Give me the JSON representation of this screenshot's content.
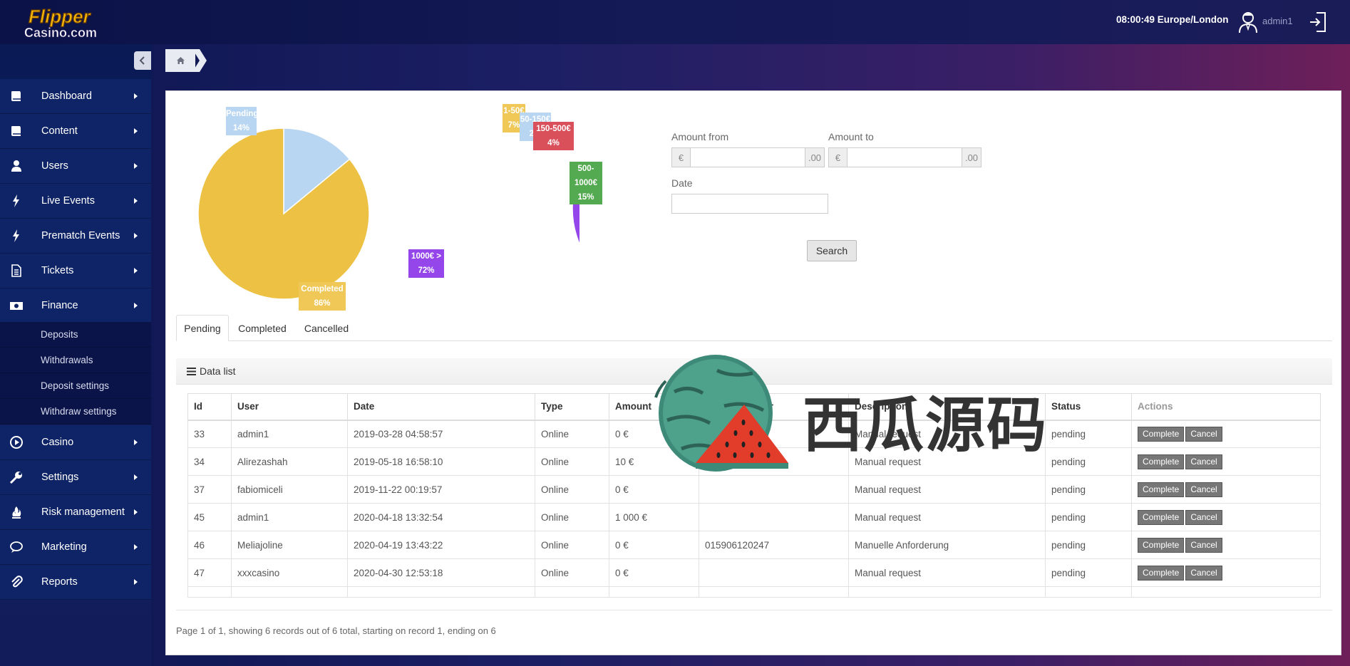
{
  "header": {
    "logo_text": "Flipper Casino.com",
    "clock": "08:00:49 Europe/London",
    "user": "admin1"
  },
  "sidebar": {
    "items": [
      {
        "label": "Dashboard",
        "icon": "book-icon"
      },
      {
        "label": "Content",
        "icon": "book-icon"
      },
      {
        "label": "Users",
        "icon": "user-icon"
      },
      {
        "label": "Live Events",
        "icon": "bolt-icon"
      },
      {
        "label": "Prematch Events",
        "icon": "bolt-icon"
      },
      {
        "label": "Tickets",
        "icon": "document-icon"
      },
      {
        "label": "Finance",
        "icon": "money-icon"
      },
      {
        "label": "Casino",
        "icon": "play-icon"
      },
      {
        "label": "Settings",
        "icon": "wrench-icon"
      },
      {
        "label": "Risk management",
        "icon": "fire-icon"
      },
      {
        "label": "Marketing",
        "icon": "chat-icon"
      },
      {
        "label": "Reports",
        "icon": "paperclip-icon"
      }
    ],
    "finance_subitems": [
      "Deposits",
      "Withdrawals",
      "Deposit settings",
      "Withdraw settings"
    ]
  },
  "chart_data": [
    {
      "type": "pie",
      "slices": [
        {
          "label": "Pending",
          "value": 14,
          "color": "#b8d6f1"
        },
        {
          "label": "Completed",
          "value": 86,
          "color": "#ecc144"
        }
      ]
    },
    {
      "type": "pie",
      "slices": [
        {
          "label": "1-50€",
          "value": 7,
          "color": "#ecc144"
        },
        {
          "label": "50-150€",
          "value": 2,
          "color": "#b8d6f1"
        },
        {
          "label": "150-500€",
          "value": 4,
          "color": "#d9505a"
        },
        {
          "label": "500-1000€",
          "value": 15,
          "color": "#54aa50"
        },
        {
          "label": "1000€ >",
          "value": 72,
          "color": "#9446ea"
        }
      ]
    }
  ],
  "filters": {
    "amount_from_label": "Amount from",
    "amount_to_label": "Amount to",
    "date_label": "Date",
    "currency_addon": "€",
    "decimal_addon": ".00",
    "search_label": "Search"
  },
  "tabs": [
    "Pending",
    "Completed",
    "Cancelled"
  ],
  "datalist_title": "Data list",
  "table": {
    "headers": [
      "Id",
      "User",
      "Date",
      "Type",
      "Amount",
      "Phone Number",
      "Description",
      "Status",
      "Actions"
    ],
    "rows": [
      [
        "33",
        "admin1",
        "2019-03-28 04:58:57",
        "Online",
        "0 €",
        "",
        "Manual request",
        "pending"
      ],
      [
        "34",
        "Alirezashah",
        "2019-05-18 16:58:10",
        "Online",
        "10 €",
        "",
        "Manual request",
        "pending"
      ],
      [
        "37",
        "fabiomiceli",
        "2019-11-22 00:19:57",
        "Online",
        "0 €",
        "",
        "Manual request",
        "pending"
      ],
      [
        "45",
        "admin1",
        "2020-04-18 13:32:54",
        "Online",
        "1 000 €",
        "",
        "Manual request",
        "pending"
      ],
      [
        "46",
        "Meliajoline",
        "2020-04-19 13:43:22",
        "Online",
        "0 €",
        "015906120247",
        "Manuelle Anforderung",
        "pending"
      ],
      [
        "47",
        "xxxcasino",
        "2020-04-30 12:53:18",
        "Online",
        "0 €",
        "",
        "Manual request",
        "pending"
      ]
    ],
    "complete_label": "Complete",
    "cancel_label": "Cancel"
  },
  "pager_text": "Page 1 of 1, showing 6 records out of 6 total, starting on record 1, ending on 6",
  "watermark_text": "西瓜源码"
}
